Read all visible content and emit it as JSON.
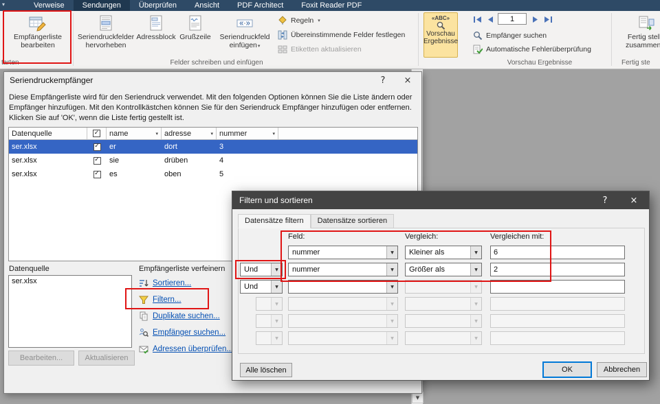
{
  "glyphs": {
    "dropdown": "▾",
    "combo_arrow": "▼",
    "check": "✓",
    "help": "?",
    "close": "×",
    "scroll_down": "▼",
    "preview_abc": "«ABC»",
    "quick_access_dropdown": "▾"
  },
  "ribbon": {
    "tabs": [
      {
        "label": "Verweise",
        "active": false
      },
      {
        "label": "Sendungen",
        "active": true
      },
      {
        "label": "Überprüfen",
        "active": false
      },
      {
        "label": "Ansicht",
        "active": false
      },
      {
        "label": "PDF Architect",
        "active": false
      },
      {
        "label": "Foxit Reader PDF",
        "active": false
      }
    ],
    "start_group": {
      "label": "tarten",
      "edit_recipient_list": {
        "line1": "Empfängerliste",
        "line2": "bearbeiten"
      }
    },
    "write_insert_group": {
      "label": "Felder schreiben und einfügen",
      "highlight_merge_fields": {
        "line1": "Seriendruckfelder",
        "line2": "hervorheben"
      },
      "address_block": "Adressblock",
      "greeting_line": "Grußzeile",
      "insert_merge_field": {
        "line1": "Seriendruckfeld",
        "line2": "einfügen"
      },
      "rules": "Regeln",
      "match_fields": "Übereinstimmende Felder festlegen",
      "update_labels": "Etiketten aktualisieren"
    },
    "preview_group": {
      "label": "Vorschau Ergebnisse",
      "preview_results": {
        "line1": "Vorschau",
        "line2": "Ergebnisse"
      },
      "record_number": "1",
      "find_recipient": "Empfänger suchen",
      "auto_check_errors": "Automatische Fehlerüberprüfung"
    },
    "finish_group": {
      "label": "Fertig ste",
      "finish_merge": {
        "line1": "Fertig stelle",
        "line2": "zusammenfü"
      }
    }
  },
  "recipients_dialog": {
    "title": "Seriendruckempfänger",
    "description": [
      "Diese Empfängerliste wird für den Seriendruck verwendet. Mit den folgenden Optionen können Sie die Liste ändern oder",
      "Empfänger hinzufügen. Mit den Kontrollkästchen können Sie für den Seriendruck Empfänger hinzufügen oder entfernen.",
      "Klicken Sie auf 'OK', wenn die Liste fertig gestellt ist."
    ],
    "table": {
      "columns": {
        "source": "Datenquelle",
        "name": "name",
        "adresse": "adresse",
        "nummer": "nummer"
      },
      "rows": [
        {
          "source": "ser.xlsx",
          "name": "er",
          "adresse": "dort",
          "nummer": "3"
        },
        {
          "source": "ser.xlsx",
          "name": "sie",
          "adresse": "drüben",
          "nummer": "4"
        },
        {
          "source": "ser.xlsx",
          "name": "es",
          "adresse": "oben",
          "nummer": "5"
        }
      ]
    },
    "datasource_label": "Datenquelle",
    "datasource_items": [
      "ser.xlsx"
    ],
    "refine_label": "Empfängerliste verfeinern",
    "links": {
      "sort": "Sortieren...",
      "filter": "Filtern...",
      "find_duplicates": "Duplikate suchen...",
      "find_recipient": "Empfänger suchen...",
      "validate_addresses": "Adressen überprüfen..."
    },
    "buttons": {
      "edit": "Bearbeiten...",
      "refresh": "Aktualisieren"
    }
  },
  "filter_dialog": {
    "title": "Filtern und sortieren",
    "tabs": [
      {
        "label": "Datensätze filtern",
        "active": true
      },
      {
        "label": "Datensätze sortieren",
        "active": false
      }
    ],
    "column_headers": {
      "field": "Feld:",
      "comparison": "Vergleich:",
      "compare_with": "Vergleichen mit:"
    },
    "rows": [
      {
        "condition": "",
        "field": "nummer",
        "comparison": "Kleiner als",
        "value": "6"
      },
      {
        "condition": "Und",
        "field": "nummer",
        "comparison": "Größer als",
        "value": "2"
      },
      {
        "condition": "Und",
        "field": "",
        "comparison": "",
        "value": ""
      },
      {
        "condition": "",
        "field": "",
        "comparison": "",
        "value": ""
      },
      {
        "condition": "",
        "field": "",
        "comparison": "",
        "value": ""
      },
      {
        "condition": "",
        "field": "",
        "comparison": "",
        "value": ""
      }
    ],
    "buttons": {
      "clear_all": "Alle löschen",
      "ok": "OK",
      "cancel": "Abbrechen"
    }
  },
  "colors": {
    "annotation_red": "#e01414",
    "selection_blue": "#3565c4",
    "ribbon_tab_bar": "#2e4a66",
    "preview_toggle_highlight": "#fbe3a0",
    "link_blue": "#0550b3",
    "active_title_bar": "#434343"
  }
}
